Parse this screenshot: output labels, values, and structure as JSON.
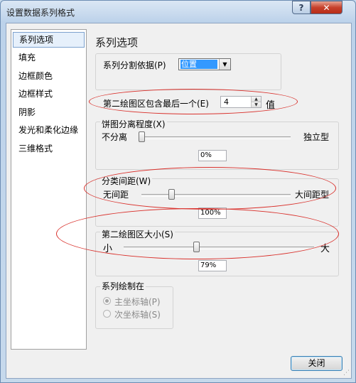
{
  "window": {
    "title": "设置数据系列格式",
    "help_label": "?",
    "close_label": "✕"
  },
  "sidebar": {
    "items": [
      {
        "label": "系列选项"
      },
      {
        "label": "填充"
      },
      {
        "label": "边框颜色"
      },
      {
        "label": "边框样式"
      },
      {
        "label": "阴影"
      },
      {
        "label": "发光和柔化边缘"
      },
      {
        "label": "三维格式"
      }
    ]
  },
  "main": {
    "heading": "系列选项",
    "split_by_label": "系列分割依据(P)",
    "split_by_value": "位置",
    "second_plot_contains_label": "第二绘图区包含最后一个(E)",
    "second_plot_contains_value": "4",
    "second_plot_contains_unit": "值",
    "pie_explosion": {
      "label": "饼图分离程度(X)",
      "min_label": "不分离",
      "max_label": "独立型",
      "value": "0%",
      "level": 0
    },
    "gap_width": {
      "label": "分类间距(W)",
      "min_label": "无间距",
      "max_label": "大间距型",
      "value": "100%",
      "level": 0.2
    },
    "second_plot_size": {
      "label": "第二绘图区大小(S)",
      "min_label": "小",
      "max_label": "大",
      "value": "79%",
      "level": 0.38
    },
    "plot_series_on": {
      "label": "系列绘制在",
      "primary_label": "主坐标轴(P)",
      "secondary_label": "次坐标轴(S)"
    }
  },
  "footer": {
    "close_button": "关闭"
  },
  "colors": {
    "annotation": "#d9312c",
    "selection": "#3399ff",
    "title_close": "#c7412c"
  }
}
